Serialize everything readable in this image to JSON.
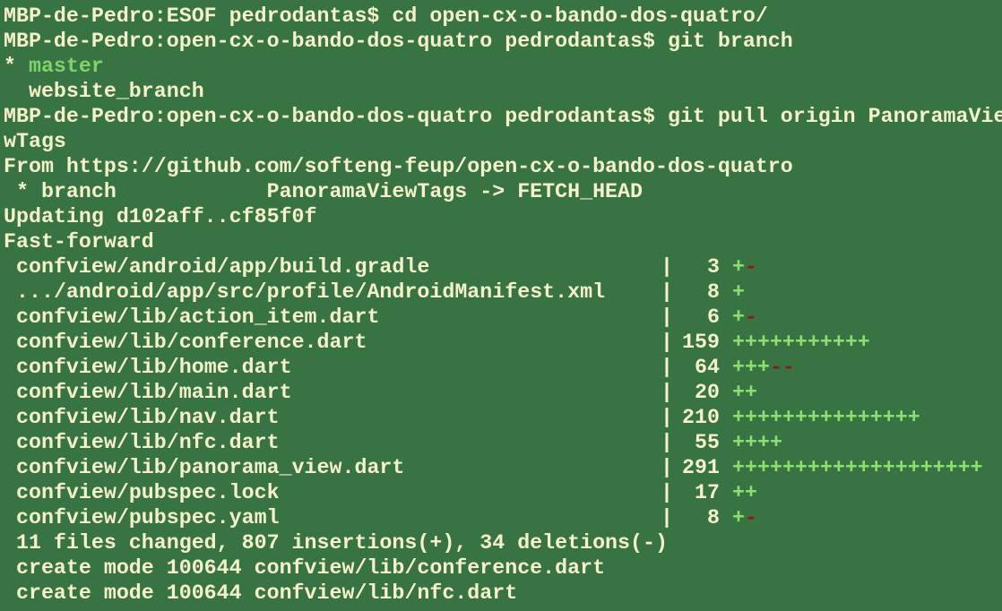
{
  "colors": {
    "background": "#387344",
    "text": "#f5f1c9",
    "current_branch": "#7fd36b",
    "plus": "#8de06e",
    "minus": "#8a1d12"
  },
  "lines": {
    "cmd_cd": "MBP-de-Pedro:ESOF pedrodantas$ cd open-cx-o-bando-dos-quatro/",
    "cmd_branch": "MBP-de-Pedro:open-cx-o-bando-dos-quatro pedrodantas$ git branch",
    "branch_current_marker": "* ",
    "branch_current_name": "master",
    "branch_other": "  website_branch",
    "cmd_pull": "MBP-de-Pedro:open-cx-o-bando-dos-quatro pedrodantas$ git pull origin PanoramaVie",
    "cmd_pull_wrap": "wTags",
    "from": "From https://github.com/softeng-feup/open-cx-o-bando-dos-quatro",
    "fetch_branch": " * branch            PanoramaViewTags -> FETCH_HEAD",
    "updating": "Updating d102aff..cf85f0f",
    "fast_forward": "Fast-forward"
  },
  "diffstat": [
    {
      "file": "confview/android/app/build.gradle",
      "count": "3",
      "plus": "+",
      "minus": "-"
    },
    {
      "file": ".../android/app/src/profile/AndroidManifest.xml",
      "count": "8",
      "plus": "+",
      "minus": ""
    },
    {
      "file": "confview/lib/action_item.dart",
      "count": "6",
      "plus": "+",
      "minus": "-"
    },
    {
      "file": "confview/lib/conference.dart",
      "count": "159",
      "plus": "+++++++++++",
      "minus": ""
    },
    {
      "file": "confview/lib/home.dart",
      "count": "64",
      "plus": "+++",
      "minus": "--"
    },
    {
      "file": "confview/lib/main.dart",
      "count": "20",
      "plus": "++",
      "minus": ""
    },
    {
      "file": "confview/lib/nav.dart",
      "count": "210",
      "plus": "+++++++++++++++",
      "minus": ""
    },
    {
      "file": "confview/lib/nfc.dart",
      "count": "55",
      "plus": "++++",
      "minus": ""
    },
    {
      "file": "confview/lib/panorama_view.dart",
      "count": "291",
      "plus": "++++++++++++++++++++",
      "minus": ""
    },
    {
      "file": "confview/pubspec.lock",
      "count": "17",
      "plus": "++",
      "minus": ""
    },
    {
      "file": "confview/pubspec.yaml",
      "count": "8",
      "plus": "+",
      "minus": "-"
    }
  ],
  "summary": {
    "changed": " 11 files changed, 807 insertions(+), 34 deletions(-)",
    "create1": " create mode 100644 confview/lib/conference.dart",
    "create2": " create mode 100644 confview/lib/nfc.dart"
  },
  "pipe_char": "|"
}
